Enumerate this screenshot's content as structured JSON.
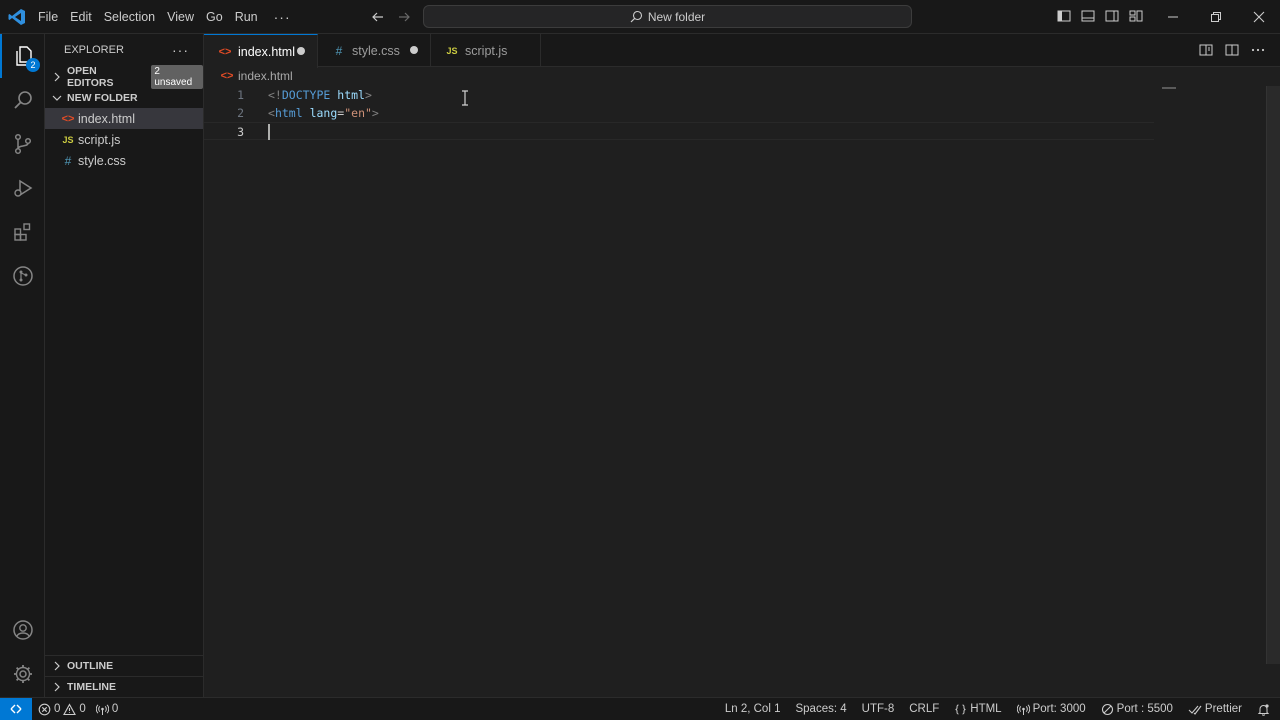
{
  "menu": {
    "items": [
      "File",
      "Edit",
      "Selection",
      "View",
      "Go",
      "Run"
    ],
    "more": "···"
  },
  "command_center": {
    "text": "New folder"
  },
  "activity": {
    "explorer_badge": "2"
  },
  "sidebar": {
    "title": "EXPLORER",
    "more": "···",
    "open_editors": {
      "label": "OPEN EDITORS",
      "badge": "2 unsaved"
    },
    "folder": {
      "label": "NEW FOLDER",
      "files": [
        {
          "name": "index.html",
          "icon": "<>",
          "type": "html"
        },
        {
          "name": "script.js",
          "icon": "JS",
          "type": "js"
        },
        {
          "name": "style.css",
          "icon": "#",
          "type": "css"
        }
      ]
    },
    "outline_label": "OUTLINE",
    "timeline_label": "TIMELINE"
  },
  "tabs": [
    {
      "name": "index.html",
      "icon": "<>",
      "dirty": true,
      "active": true
    },
    {
      "name": "style.css",
      "icon": "#",
      "dirty": true,
      "active": false
    },
    {
      "name": "script.js",
      "icon": "JS",
      "dirty": false,
      "active": false
    }
  ],
  "breadcrumb": {
    "file": "index.html",
    "icon": "<>"
  },
  "editor": {
    "line_numbers": [
      "1",
      "2",
      "3"
    ],
    "line1": {
      "open": "<!",
      "kw": "DOCTYPE",
      "space": " ",
      "name": "html",
      "close": ">"
    },
    "line2": {
      "open": "<",
      "tag": "html",
      "space": " ",
      "attr": "lang",
      "eq": "=",
      "str": "\"en\"",
      "close": ">"
    }
  },
  "status": {
    "errors": "0",
    "warnings": "0",
    "ports": "0",
    "position": "Ln 2, Col 1",
    "spaces": "Spaces: 4",
    "encoding": "UTF-8",
    "eol": "CRLF",
    "language": "HTML",
    "port_primary": "Port: 3000",
    "port_secondary": "Port : 5500",
    "formatter": "Prettier"
  },
  "colors": {
    "accent": "#0078d4",
    "html_icon": "#e34c26",
    "js_icon": "#cbcb41",
    "css_icon": "#519aba"
  }
}
